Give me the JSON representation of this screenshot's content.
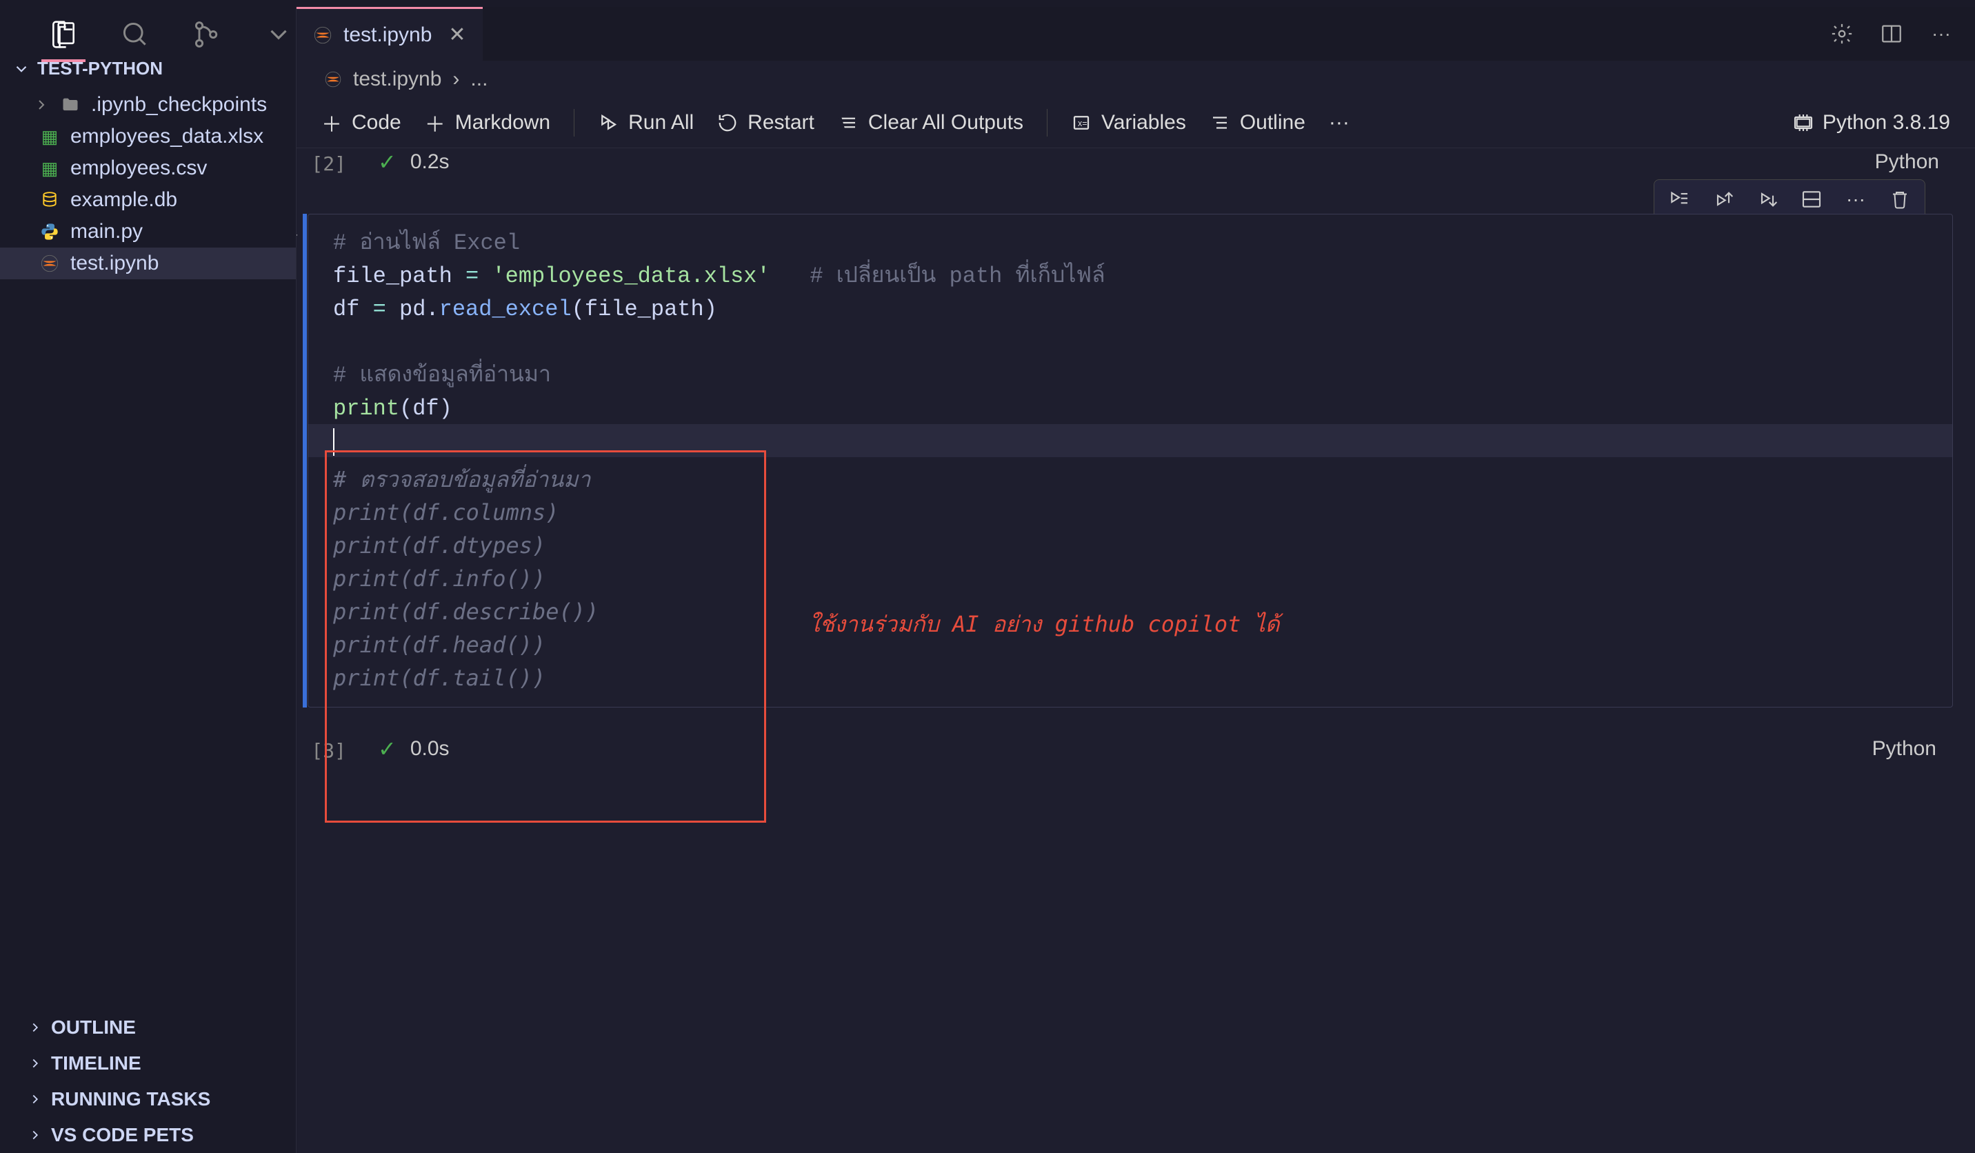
{
  "titlebar": {
    "project": "test-python"
  },
  "explorer": {
    "title": "TEST-PYTHON",
    "folder": ".ipynb_checkpoints",
    "files": [
      {
        "name": "employees_data.xlsx",
        "icon": "xlsx"
      },
      {
        "name": "employees.csv",
        "icon": "csv"
      },
      {
        "name": "example.db",
        "icon": "db"
      },
      {
        "name": "main.py",
        "icon": "py"
      },
      {
        "name": "test.ipynb",
        "icon": "ipynb",
        "selected": true
      }
    ],
    "bottomPanels": [
      "OUTLINE",
      "TIMELINE",
      "RUNNING TASKS",
      "VS CODE PETS"
    ]
  },
  "tab": {
    "filename": "test.ipynb"
  },
  "breadcrumb": {
    "filename": "test.ipynb",
    "rest": "..."
  },
  "toolbar": {
    "code": "Code",
    "markdown": "Markdown",
    "runAll": "Run All",
    "restart": "Restart",
    "clearAll": "Clear All Outputs",
    "variables": "Variables",
    "outline": "Outline",
    "more": "···",
    "kernel": "Python 3.8.19"
  },
  "prevCell": {
    "execCount": "[2]",
    "timing": "0.2s",
    "lang": "Python"
  },
  "codeCell": {
    "execCount": "[3]",
    "timing": "0.0s",
    "lang": "Python",
    "lines": {
      "comment1": "# อ่านไฟล์ Excel",
      "line2_var": "file_path",
      "line2_eq": " = ",
      "line2_str": "'employees_data.xlsx'",
      "line2_comment": "# เปลี่ยนเป็น path ที่เก็บไฟล์",
      "line3_df": "df",
      "line3_eq": " = ",
      "line3_pd": "pd",
      "line3_dot": ".",
      "line3_read": "read_excel",
      "line3_paren": "(file_path)",
      "comment2": "# แสดงข้อมูลที่อ่านมา",
      "print_kw": "print",
      "print_arg": "(df)"
    },
    "ghost": [
      "# ตรวจสอบข้อมูลที่อ่านมา",
      "print(df.columns)",
      "print(df.dtypes)",
      "print(df.info())",
      "print(df.describe())",
      "print(df.head())",
      "print(df.tail())"
    ],
    "annotation": "ใช้งานร่วมกับ AI อย่าง github copilot ได้"
  }
}
